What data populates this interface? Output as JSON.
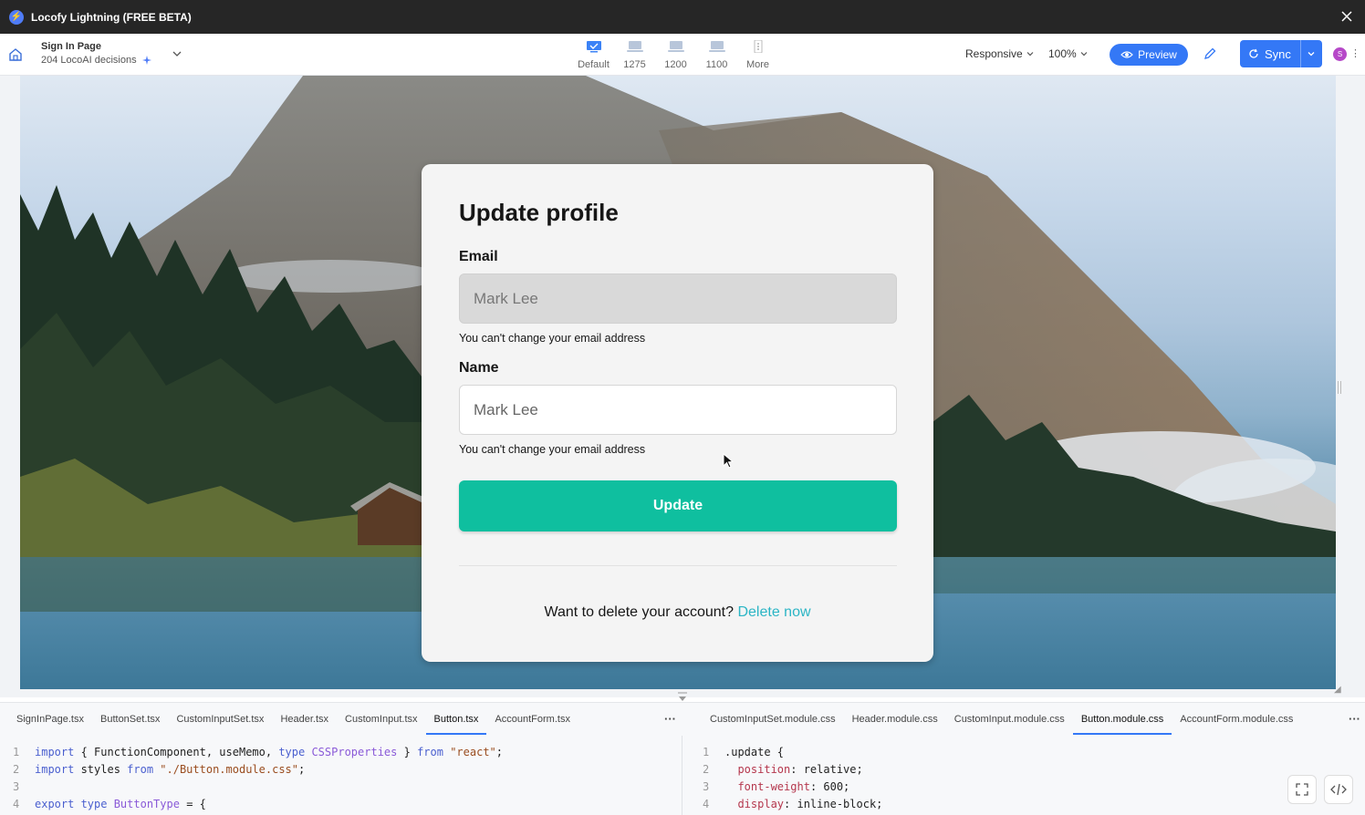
{
  "window": {
    "title": "Locofy Lightning (FREE BETA)"
  },
  "toolbar": {
    "page_title": "Sign In Page",
    "page_sub": "204 LocoAI decisions",
    "devices": [
      {
        "label": "Default"
      },
      {
        "label": "1275"
      },
      {
        "label": "1200"
      },
      {
        "label": "1100"
      },
      {
        "label": "More"
      }
    ],
    "responsive_label": "Responsive",
    "zoom_label": "100%",
    "preview_label": "Preview",
    "sync_label": "Sync",
    "avatar_initial": "S"
  },
  "form": {
    "title": "Update profile",
    "email_label": "Email",
    "email_value": "Mark Lee",
    "email_help": "You can't change your email address",
    "name_label": "Name",
    "name_value": "Mark Lee",
    "name_help": "You can't change your email address",
    "update_label": "Update",
    "delete_prompt": "Want to delete your account?",
    "delete_link": "Delete now"
  },
  "colors": {
    "accent": "#3478f6",
    "update_button": "#0fbf9f",
    "delete_link": "#2bb5c5"
  },
  "editor": {
    "left_tabs": [
      {
        "label": "SignInPage.tsx"
      },
      {
        "label": "ButtonSet.tsx"
      },
      {
        "label": "CustomInputSet.tsx"
      },
      {
        "label": "Header.tsx"
      },
      {
        "label": "CustomInput.tsx"
      },
      {
        "label": "Button.tsx"
      },
      {
        "label": "AccountForm.tsx"
      }
    ],
    "right_tabs": [
      {
        "label": "CustomInputSet.module.css"
      },
      {
        "label": "Header.module.css"
      },
      {
        "label": "CustomInput.module.css"
      },
      {
        "label": "Button.module.css"
      },
      {
        "label": "AccountForm.module.css"
      }
    ],
    "left_code": {
      "line_numbers": [
        "1",
        "2",
        "3",
        "4"
      ],
      "l1_import": "import",
      "l1_body": " { FunctionComponent, useMemo, ",
      "l1_type": "type",
      "l1_cssprops": " CSSProperties",
      "l1_close": " } ",
      "l1_from": "from",
      "l1_str": " \"react\"",
      "l1_semi": ";",
      "l2_import": "import",
      "l2_body": " styles ",
      "l2_from": "from",
      "l2_str": " \"./Button.module.css\"",
      "l2_semi": ";",
      "l4_export": "export",
      "l4_type": " type",
      "l4_name": " ButtonType",
      "l4_rest": " = {"
    },
    "right_code": {
      "line_numbers": [
        "1",
        "2",
        "3",
        "4"
      ],
      "l1": ".update {",
      "l2_prop": "position",
      "l2_val": ": relative;",
      "l3_prop": "font-weight",
      "l3_val": ": 600;",
      "l4_prop": "display",
      "l4_val": ": inline-block;"
    }
  }
}
